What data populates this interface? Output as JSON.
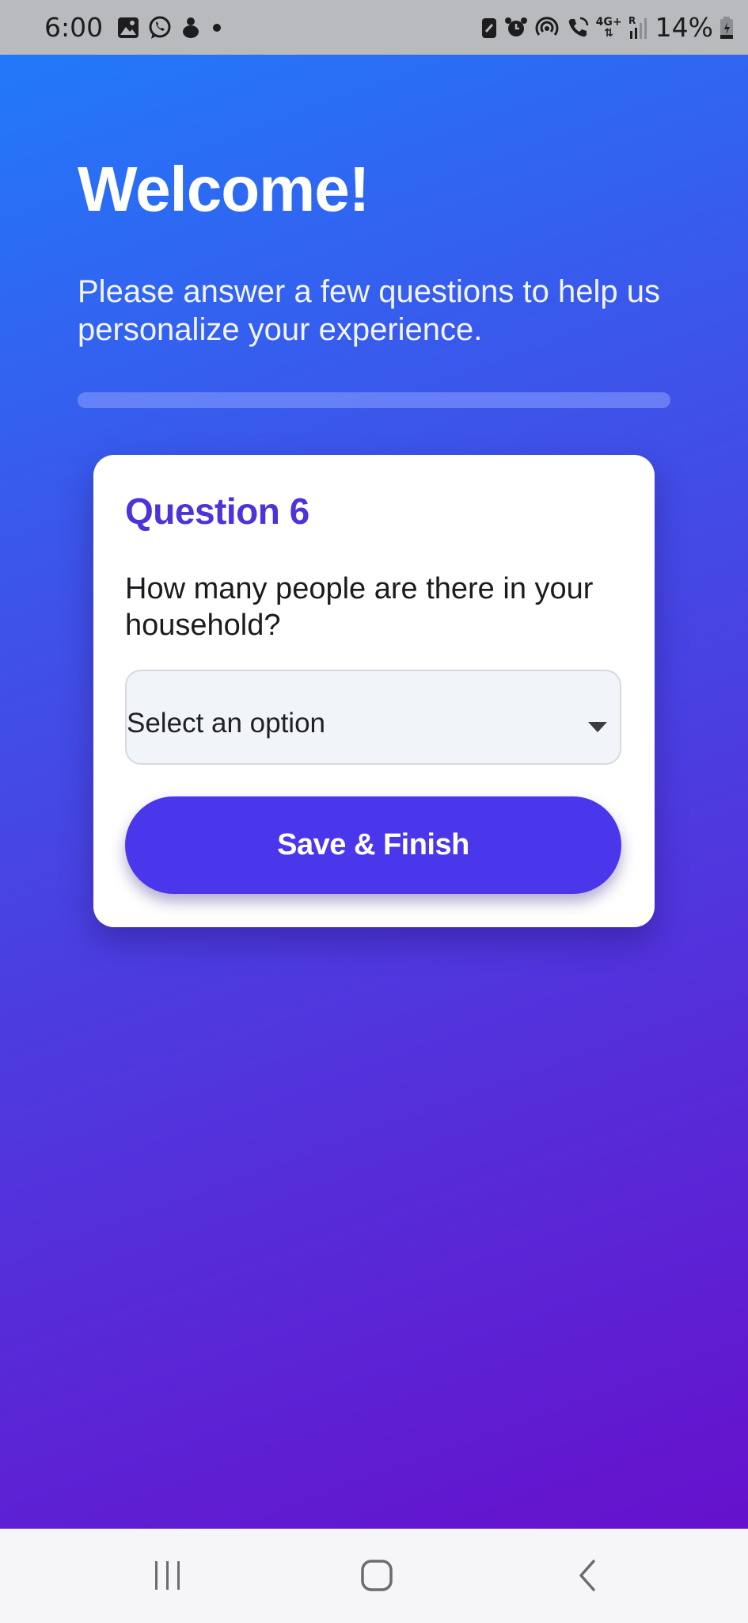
{
  "status_bar": {
    "time": "6:00",
    "left_icons": [
      "gallery-icon",
      "whatsapp-icon",
      "app-notification-icon",
      "dot-icon"
    ],
    "right_icons": [
      "battery-saver-icon",
      "alarm-icon",
      "hotspot-icon",
      "wifi-call-icon",
      "signal-icon"
    ],
    "network_type": "4G+",
    "roaming": "R",
    "battery": "14%"
  },
  "header": {
    "title": "Welcome!",
    "subtitle": "Please answer a few questions to help us personalize your experience.",
    "progress": 0.0
  },
  "question_card": {
    "label": "Question 6",
    "text": "How many people are there in your household?",
    "select_value": "Select an option",
    "button_label": "Save & Finish"
  },
  "colors": {
    "gradient_start": "#2279fa",
    "gradient_end": "#6611cc",
    "accent": "#4a37ec",
    "question_label": "#4b34d9"
  },
  "nav_bar": {
    "buttons": [
      "recent-apps-icon",
      "home-icon",
      "back-icon"
    ]
  }
}
